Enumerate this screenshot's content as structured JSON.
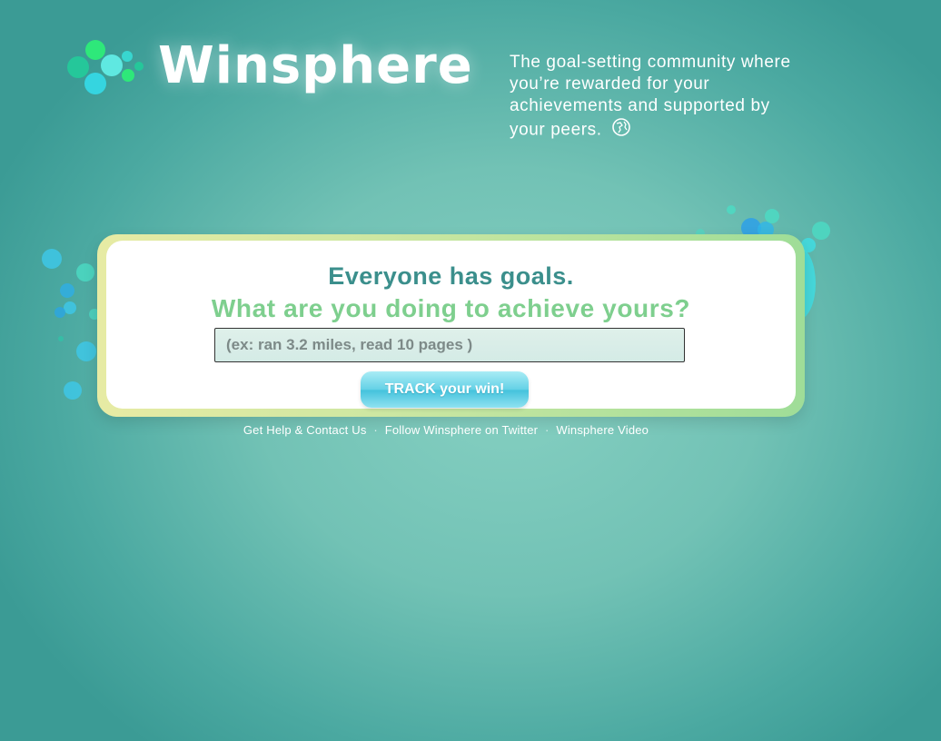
{
  "brand": {
    "name": "Winsphere",
    "tagline": "The goal-setting community where you’re rewarded for your achievements and supported by your peers."
  },
  "main": {
    "headline": "Everyone has goals.",
    "subheadline": "What are you doing to achieve yours?",
    "goal_input": {
      "value": "",
      "placeholder": "(ex: ran 3.2 miles, read 10 pages )"
    },
    "track_button": "TRACK your win!"
  },
  "footer": {
    "links": [
      "Get Help & Contact Us",
      "Follow Winsphere on Twitter",
      "Winsphere Video"
    ],
    "separator": "·"
  },
  "colors": {
    "background": "#72c2b5",
    "headline": "#3b8f8c",
    "subheadline": "#7ecf8e",
    "button": "#64d1e6",
    "card_border": "#cde7a2"
  },
  "icons": [
    "logo-dots-icon",
    "globe-icon"
  ]
}
